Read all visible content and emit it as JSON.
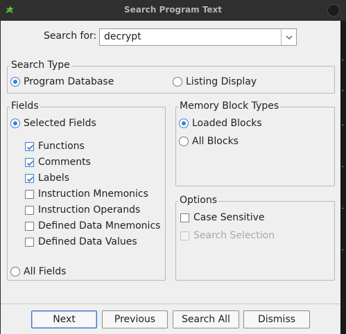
{
  "window": {
    "title": "Search Program Text"
  },
  "search": {
    "label": "Search for:",
    "value": "decrypt"
  },
  "search_type": {
    "legend": "Search Type",
    "options": [
      {
        "label": "Program Database",
        "selected": true
      },
      {
        "label": "Listing Display",
        "selected": false
      }
    ]
  },
  "fields": {
    "legend": "Fields",
    "selected_fields_label": "Selected Fields",
    "items": [
      {
        "label": "Functions",
        "checked": true
      },
      {
        "label": "Comments",
        "checked": true
      },
      {
        "label": "Labels",
        "checked": true
      },
      {
        "label": "Instruction Mnemonics",
        "checked": false
      },
      {
        "label": "Instruction Operands",
        "checked": false
      },
      {
        "label": "Defined Data Mnemonics",
        "checked": false
      },
      {
        "label": "Defined Data Values",
        "checked": false
      }
    ],
    "all_fields_label": "All Fields"
  },
  "memory": {
    "legend": "Memory Block Types",
    "options": [
      {
        "label": "Loaded Blocks",
        "selected": true
      },
      {
        "label": "All Blocks",
        "selected": false
      }
    ]
  },
  "options": {
    "legend": "Options",
    "case_sensitive": "Case Sensitive",
    "search_selection": "Search Selection"
  },
  "buttons": {
    "next": "Next",
    "previous": "Previous",
    "search_all": "Search All",
    "dismiss": "Dismiss"
  },
  "colors": {
    "accent": "#3b7fd8",
    "dialog_bg": "#efefef",
    "titlebar_bg": "#2f2f2f"
  },
  "icons": {
    "app": "dragon-icon",
    "dropdown": "chevron-down-icon"
  }
}
